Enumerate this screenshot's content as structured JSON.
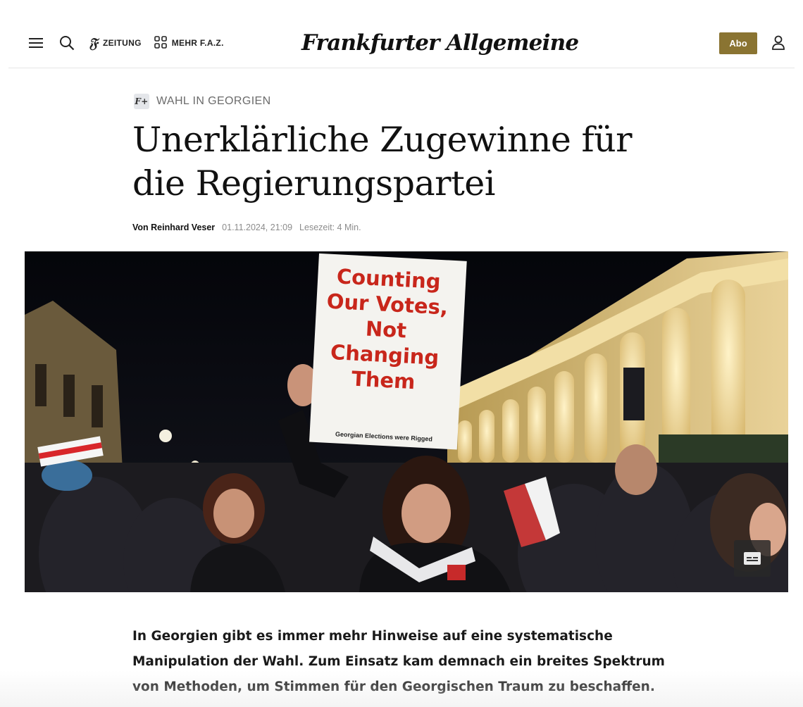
{
  "header": {
    "menu_icon": "hamburger-menu-icon",
    "search_icon": "search-icon",
    "zeitung_label": "ZEITUNG",
    "mehr_label": "MEHR F.A.Z.",
    "logo_text": "Frankfurter Allgemeine",
    "abo_label": "Abo",
    "user_icon": "user-icon",
    "accent_color": "#8a7432"
  },
  "article": {
    "kicker_badge": "F+",
    "kicker": "WAHL IN GEORGIEN",
    "headline": "Unerklärliche Zugewinne für die Regierungspartei",
    "author": "Von Reinhard Veser",
    "date": "01.11.2024, 21:09",
    "reading_time": "Lesezeit: 4 Min.",
    "lead": "In Georgien gibt es immer mehr Hinweise auf eine systematische Manipulation der Wahl. Zum Einsatz kam demnach ein breites Spektrum von Methoden, um Stimmen für den Georgischen Traum zu beschaffen."
  },
  "image": {
    "sign_text": "Counting Our Votes, Not Changing Them",
    "sign_subtext": "Georgian Elections were Rigged",
    "caption_icon": "caption-icon"
  }
}
